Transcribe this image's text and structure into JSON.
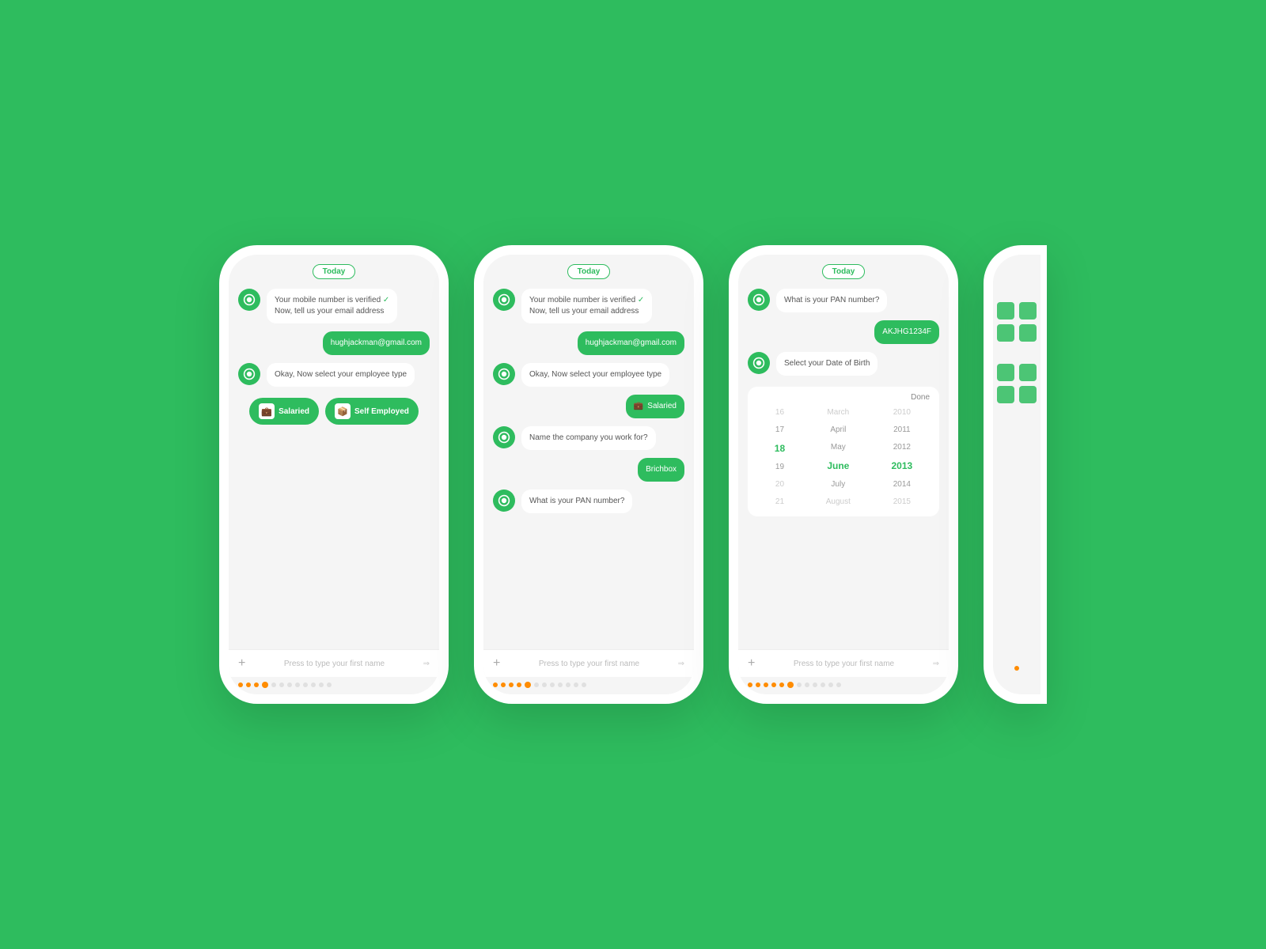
{
  "bg_color": "#2ebc5e",
  "phones": [
    {
      "id": "phone1",
      "today_label": "Today",
      "messages": [
        {
          "type": "bot",
          "text": "Your mobile number is verified",
          "subtext": "Now, tell us your email address",
          "verified": true
        },
        {
          "type": "user",
          "text": "hughjackman@gmail.com"
        },
        {
          "type": "bot",
          "text": "Okay, Now select your employee type",
          "subtext": ""
        }
      ],
      "buttons": [
        {
          "label": "Salaried",
          "icon": "💼"
        },
        {
          "label": "Self Employed",
          "icon": "📦"
        }
      ],
      "footer_placeholder": "Press to type your first name",
      "progress_filled": 4,
      "progress_active": 4,
      "progress_total": 12
    },
    {
      "id": "phone2",
      "today_label": "Today",
      "messages": [
        {
          "type": "bot",
          "text": "Your mobile number is verified",
          "subtext": "Now, tell us your email address",
          "verified": true
        },
        {
          "type": "user",
          "text": "hughjackman@gmail.com"
        },
        {
          "type": "bot",
          "text": "Okay, Now select your employee type",
          "subtext": ""
        },
        {
          "type": "user",
          "text": "Salaried",
          "icon": "💼"
        },
        {
          "type": "bot",
          "text": "Name the company you work for?",
          "subtext": ""
        },
        {
          "type": "user",
          "text": "Brichbox"
        },
        {
          "type": "bot",
          "text": "What is your PAN number?",
          "subtext": ""
        }
      ],
      "footer_placeholder": "Press to type your first name",
      "progress_filled": 5,
      "progress_active": 5,
      "progress_total": 12
    },
    {
      "id": "phone3",
      "today_label": "Today",
      "messages": [
        {
          "type": "bot",
          "text": "What is your PAN number?",
          "subtext": ""
        },
        {
          "type": "user",
          "text": "AKJHG1234F"
        },
        {
          "type": "bot",
          "text": "Select your Date of Birth",
          "subtext": ""
        }
      ],
      "date_picker": {
        "done_label": "Done",
        "columns": [
          {
            "id": "day",
            "items": [
              "16",
              "17",
              "18",
              "19",
              "20",
              "21"
            ],
            "selected": "18"
          },
          {
            "id": "month",
            "items": [
              "March",
              "April",
              "May",
              "June",
              "July",
              "August"
            ],
            "selected": "June"
          },
          {
            "id": "year",
            "items": [
              "2010",
              "2011",
              "2012",
              "2013",
              "2014",
              "2015"
            ],
            "selected": "2013"
          }
        ]
      },
      "footer_placeholder": "Press to type your first name",
      "progress_filled": 6,
      "progress_active": 6,
      "progress_total": 12
    }
  ],
  "partial_phone": {
    "id": "phone4_partial"
  }
}
